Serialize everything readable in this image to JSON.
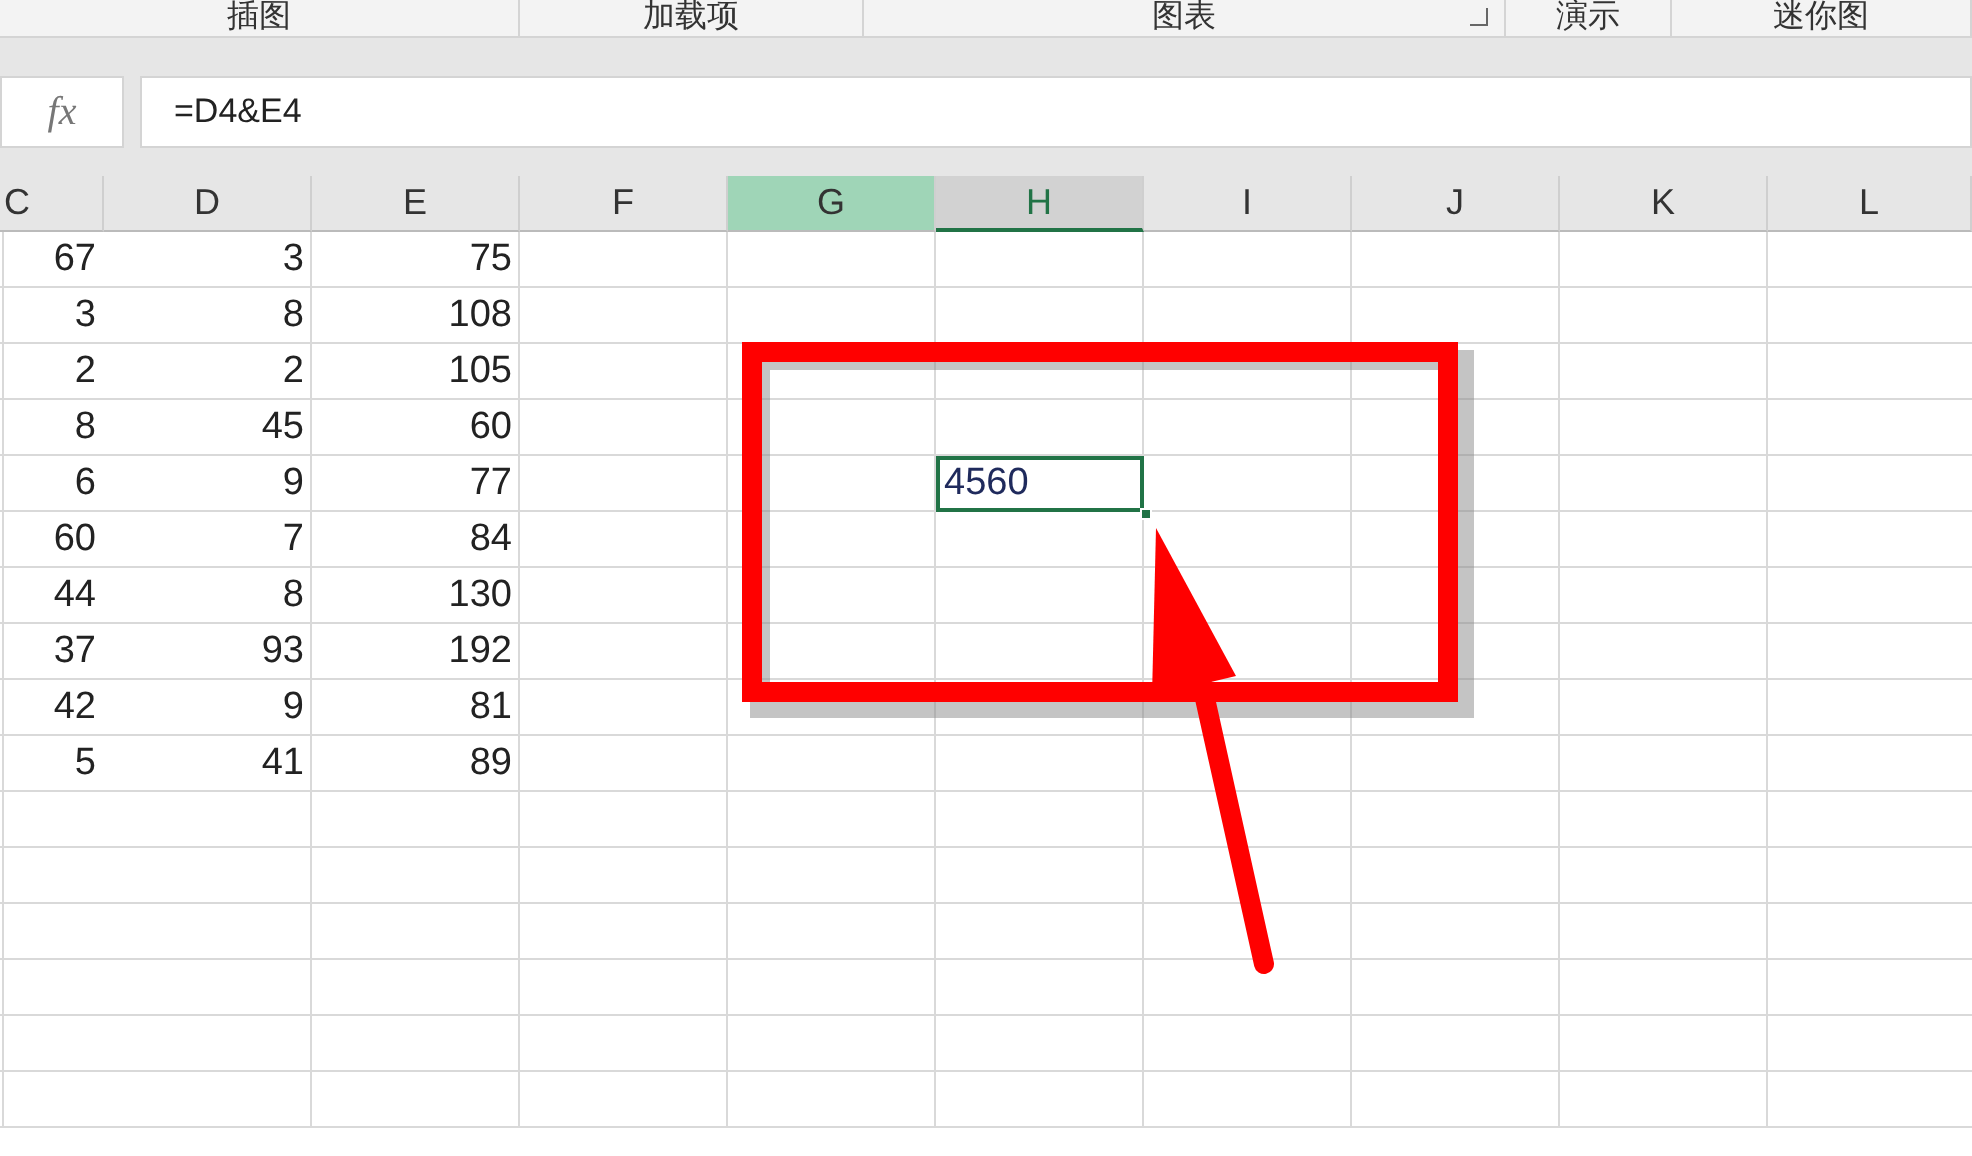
{
  "ribbon_groups": [
    {
      "label": "插图",
      "launcher": false
    },
    {
      "label": "加载项",
      "launcher": false
    },
    {
      "label": "图表",
      "launcher": true
    },
    {
      "label": "演示",
      "launcher": false
    },
    {
      "label": "迷你图",
      "launcher": false
    }
  ],
  "formula_bar": {
    "function_label": "fx",
    "formula": "=D4&E4"
  },
  "columns": [
    {
      "label": "C",
      "selected": false,
      "highlighted": false
    },
    {
      "label": "D",
      "selected": false,
      "highlighted": false
    },
    {
      "label": "E",
      "selected": false,
      "highlighted": false
    },
    {
      "label": "F",
      "selected": false,
      "highlighted": false
    },
    {
      "label": "G",
      "selected": false,
      "highlighted": true
    },
    {
      "label": "H",
      "selected": true,
      "highlighted": false
    },
    {
      "label": "I",
      "selected": false,
      "highlighted": false
    },
    {
      "label": "J",
      "selected": false,
      "highlighted": false
    },
    {
      "label": "K",
      "selected": false,
      "highlighted": false
    },
    {
      "label": "L",
      "selected": false,
      "highlighted": false
    }
  ],
  "rows": [
    {
      "cells": [
        "67",
        "3",
        "75"
      ]
    },
    {
      "cells": [
        "3",
        "8",
        "108"
      ]
    },
    {
      "cells": [
        "2",
        "2",
        "105"
      ]
    },
    {
      "cells": [
        "8",
        "45",
        "60"
      ]
    },
    {
      "cells": [
        "6",
        "9",
        "77"
      ],
      "selected_cell": {
        "value": "4560"
      }
    },
    {
      "cells": [
        "60",
        "7",
        "84"
      ]
    },
    {
      "cells": [
        "44",
        "8",
        "130"
      ]
    },
    {
      "cells": [
        "37",
        "93",
        "192"
      ]
    },
    {
      "cells": [
        "42",
        "9",
        "81"
      ]
    },
    {
      "cells": [
        "5",
        "41",
        "89"
      ]
    }
  ]
}
